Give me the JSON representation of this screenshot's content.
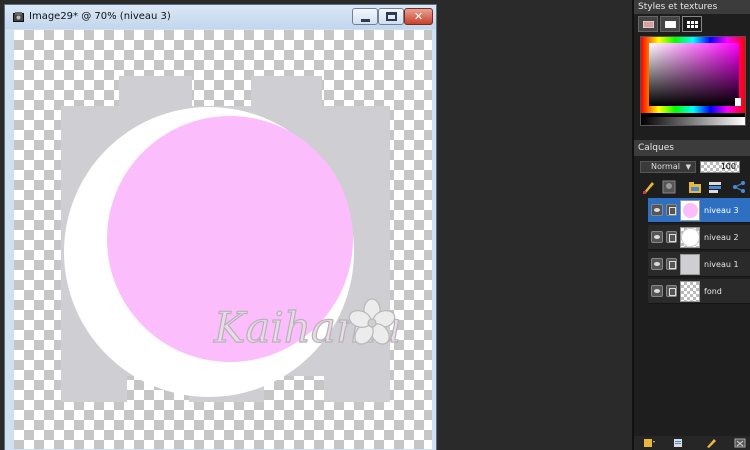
{
  "window": {
    "title": "Image29* @  70% (niveau 3)",
    "buttons": {
      "minimize": "minimize",
      "maximize": "maximize",
      "close": "✕"
    }
  },
  "canvas": {
    "watermark": "Kaihania",
    "colors": {
      "pink": "#fbbdfb",
      "white": "#ffffff",
      "grey": "#cfcfd3"
    }
  },
  "styles_panel": {
    "title": "Styles et textures"
  },
  "layers_panel": {
    "title": "Calques",
    "blend_mode": "Normal",
    "opacity": "100",
    "layers": [
      {
        "name": "niveau 3",
        "active": true,
        "thumb": "pink-circle"
      },
      {
        "name": "niveau 2",
        "active": false,
        "thumb": "white-circle"
      },
      {
        "name": "niveau 1",
        "active": false,
        "thumb": "grey-shape"
      },
      {
        "name": "fond",
        "active": false,
        "thumb": "transparent"
      }
    ]
  },
  "colors": {
    "accent_selected": "#2f6fc2",
    "dock_bg": "#1e1e1e",
    "workspace_bg": "#2a2a2a"
  }
}
